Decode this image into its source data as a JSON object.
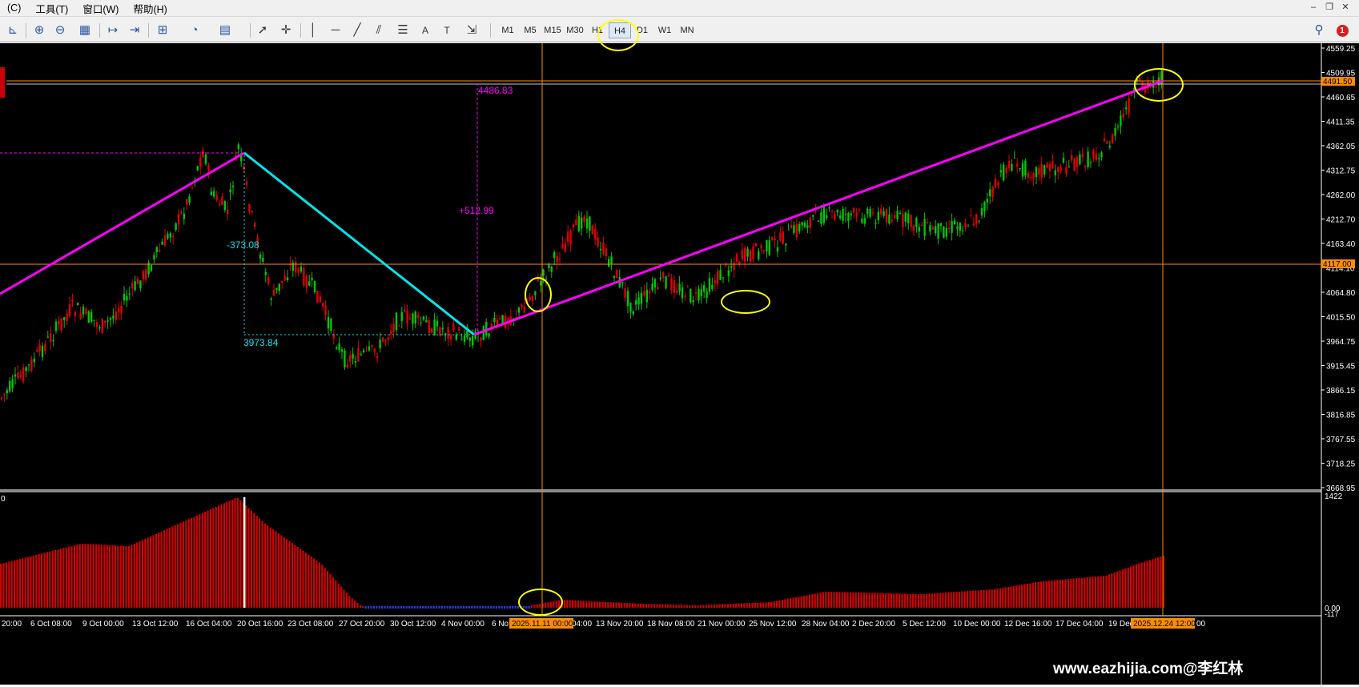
{
  "menu": [
    "(C)",
    "工具(T)",
    "窗口(W)",
    "帮助(H)"
  ],
  "window_controls": [
    "–",
    "❐",
    "✕"
  ],
  "toolbar": {
    "timeframes": [
      "M1",
      "M5",
      "M15",
      "M30",
      "H1",
      "H4",
      "D1",
      "W1",
      "MN"
    ],
    "selected_timeframe": "H4",
    "notification_count": "1"
  },
  "price_axis": {
    "ticks": [
      "4559.25",
      "4509.95",
      "4460.65",
      "4411.35",
      "4362.05",
      "4312.75",
      "4262.00",
      "4212.70",
      "4163.40",
      "4114.10",
      "4064.80",
      "4015.50",
      "3964.75",
      "3915.45",
      "3866.15",
      "3816.85",
      "3767.55",
      "3718.25",
      "3668.95"
    ],
    "current_price": "4491.50",
    "hline_price": "4117.00"
  },
  "annotations": {
    "top_price": "4486.83",
    "rise": "+512.99",
    "drop": "-373.08",
    "low_price": "3973.84"
  },
  "indicator_axis": {
    "max": "1422",
    "zero": "0.00",
    "min": "-117"
  },
  "indicator_label": "0",
  "time_axis": {
    "labels": [
      "20:00",
      "6 Oct 08:00",
      "9 Oct 00:00",
      "13 Oct 12:00",
      "16 Oct 04:00",
      "20 Oct 16:00",
      "23 Oct 08:00",
      "27 Oct 20:00",
      "30 Oct 12:00",
      "4 Nov 00:00",
      "6 No",
      "04:00",
      "13 Nov 20:00",
      "18 Nov 08:00",
      "21 Nov 00:00",
      "25 Nov 12:00",
      "28 Nov 04:00",
      "2 Dec 20:00",
      "5 Dec 12:00",
      "10 Dec 00:00",
      "12 Dec 16:00",
      "17 Dec 04:00",
      "19 Dec",
      "00"
    ],
    "crosshair_1": "2025.11.11 00:00",
    "crosshair_2": "2025.12.24 12:00"
  },
  "watermark": "www.eazhijia.com@李红林",
  "colors": {
    "background": "#000000",
    "bull": "#00c800",
    "bear": "#e00000",
    "trendline": "#ff00ff",
    "drop_line": "#00e5ee",
    "crosshair": "#ff8c00",
    "highlight": "#ffff00"
  }
}
